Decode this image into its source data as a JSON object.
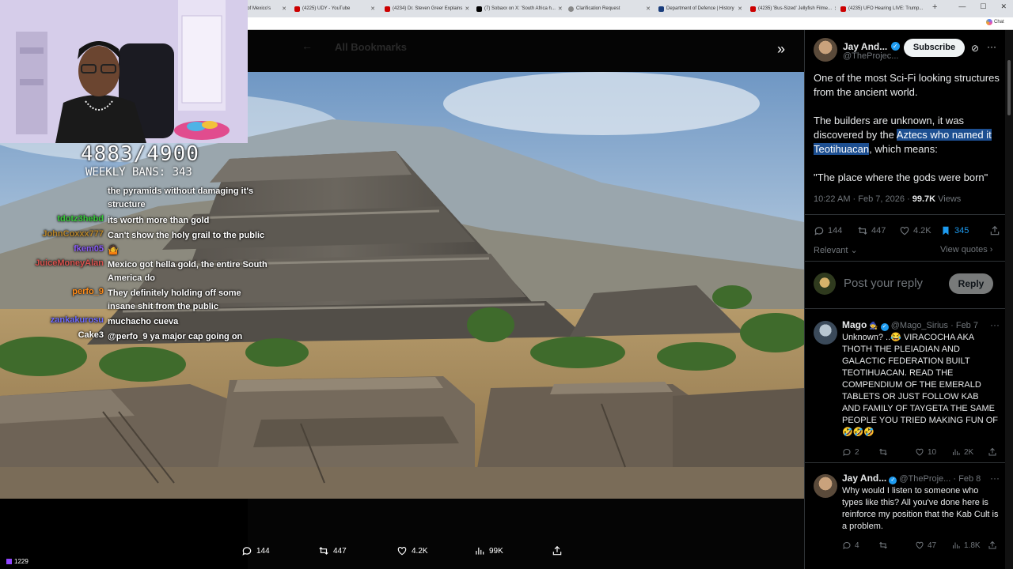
{
  "browser": {
    "tabs": [
      {
        "label": "rts of Mexico's"
      },
      {
        "label": "(4225) UDY - YouTube"
      },
      {
        "label": "(4234) Dr. Steven Greer Explains"
      },
      {
        "label": "(7) Sobaxx on X: 'South Africa h..."
      },
      {
        "label": "Clarification Request"
      },
      {
        "label": "Department of Defence | History"
      },
      {
        "label": "(4235) 'Bus-Sized' Jellyfish Filme..."
      },
      {
        "label": "(4235) UFO Hearing LIVE: Trump..."
      }
    ],
    "chat_chip": "Chat"
  },
  "background_page": {
    "title": "All Bookmarks"
  },
  "stream": {
    "counter": "4883/4900",
    "weekly_bans": "WEEKLY BANS: 343",
    "viewer_count": "1229",
    "chat": [
      {
        "user": "",
        "color": "#ffffff",
        "message": "the pyramids without damaging it's structure"
      },
      {
        "user": "tdotz3hebd",
        "color": "#38c93a",
        "message": "its worth more than gold"
      },
      {
        "user": "JohnCoxxx777",
        "color": "#b8862b",
        "message": "Can't show the holy grail to the public"
      },
      {
        "user": "fkem05",
        "color": "#8a5cf5",
        "message": "🤷"
      },
      {
        "user": "JuiceMoneyAlan",
        "color": "#d9534f",
        "message": "Mexico got hella gold, the entire South America do"
      },
      {
        "user": "perfo_9",
        "color": "#ff8c1a",
        "message": "They definitely holding off some insane shit from the public"
      },
      {
        "user": "zankakurosu",
        "color": "#6f6cff",
        "message": "muchacho cueva"
      },
      {
        "user": "Cake3",
        "color": "#ffffff",
        "message": "@perfo_9 ya major cap going on"
      }
    ]
  },
  "media_actions": {
    "replies": "144",
    "reposts": "447",
    "likes": "4.2K",
    "views": "99K"
  },
  "tweet": {
    "author_name": "Jay And...",
    "author_handle": "@TheProjec...",
    "subscribe_label": "Subscribe",
    "text_line1": "One of the most Sci-Fi looking structures from the ancient world.",
    "text_part2a": "The builders are unknown, it was discovered by the ",
    "text_highlight": "Aztecs who named it Teotihuacan",
    "text_part2b": ", which means:",
    "text_line3": "\"The place where the gods were born\"",
    "timestamp": "10:22 AM · Feb 7, 2026 · ",
    "views_count": "99.7K",
    "views_label": " Views",
    "replies": "144",
    "reposts": "447",
    "likes": "4.2K",
    "bookmarks": "345",
    "sort_label": "Relevant",
    "view_quotes": "View quotes",
    "reply_placeholder": "Post your reply",
    "reply_button": "Reply"
  },
  "replies": [
    {
      "name": "Mago",
      "handle": "@Mago_Sirius",
      "date": "· Feb 7",
      "text": "Unknown? ..😂 VIRACOCHA AKA THOTH THE PLEIADIAN AND GALACTIC FEDERATION BUILT TEOTIHUACAN. READ THE COMPENDIUM OF THE EMERALD TABLETS OR JUST FOLLOW KAB AND FAMILY OF TAYGETA THE SAME PEOPLE YOU TRIED MAKING FUN OF 🤣🤣🤣",
      "replies": "2",
      "reposts": "",
      "likes": "10",
      "views": "2K"
    },
    {
      "name": "Jay And...",
      "handle": "@TheProje...",
      "date": "· Feb 8",
      "text": "Why would I listen to someone who types like this? All you've done here is reinforce my position that the Kab Cult is a problem.",
      "replies": "4",
      "reposts": "",
      "likes": "47",
      "views": "1.8K"
    }
  ],
  "colors": {
    "accent_blue": "#1d9bf0",
    "verified": "#1d9bf0",
    "highlight": "#1d4f91"
  }
}
